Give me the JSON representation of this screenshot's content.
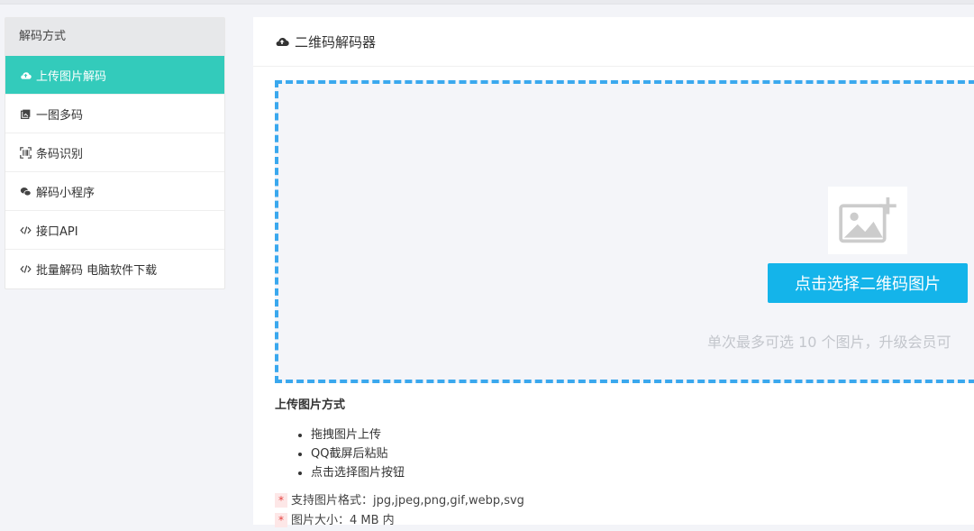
{
  "sidebar": {
    "heading": "解码方式",
    "items": [
      {
        "label": "上传图片解码",
        "icon": "cloud-upload-icon",
        "active": true
      },
      {
        "label": "一图多码",
        "icon": "images-icon",
        "active": false
      },
      {
        "label": "条码识别",
        "icon": "barcode-scan-icon",
        "active": false
      },
      {
        "label": "解码小程序",
        "icon": "wechat-icon",
        "active": false
      },
      {
        "label": "接口API",
        "icon": "code-icon",
        "active": false
      },
      {
        "label": "批量解码 电脑软件下载",
        "icon": "code-icon",
        "active": false
      }
    ]
  },
  "panel": {
    "title": "二维码解码器",
    "title_icon": "cloud-upload-icon"
  },
  "dropzone": {
    "placeholder_icon": "image-add-icon",
    "button_label": "点击选择二维码图片",
    "hint": "单次最多可选 10 个图片，升级会员可"
  },
  "upload_methods": {
    "title": "上传图片方式",
    "items": [
      "拖拽图片上传",
      "QQ截屏后粘贴",
      "点击选择图片按钮"
    ]
  },
  "notes": {
    "star": "*",
    "formats": "支持图片格式：jpg,jpeg,png,gif,webp,svg",
    "size": "图片大小：4 MB 内"
  },
  "colors": {
    "active_item": "#33cbbb",
    "button": "#14b4ea",
    "dashed_border": "#3aa8ee"
  }
}
